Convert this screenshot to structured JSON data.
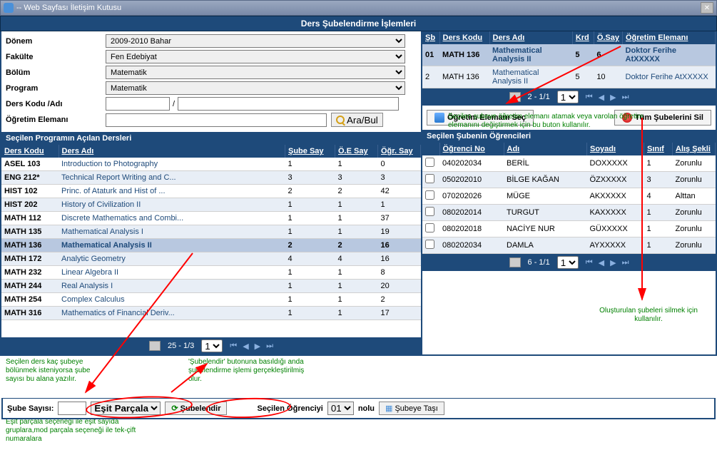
{
  "window": {
    "title": "-- Web Sayfası İletişim Kutusu"
  },
  "header": {
    "title": "Ders Şubelendirme İşlemleri"
  },
  "filters": {
    "donem_label": "Dönem",
    "donem_value": "2009-2010 Bahar",
    "fakulte_label": "Fakülte",
    "fakulte_value": "Fen Edebiyat",
    "bolum_label": "Bölüm",
    "bolum_value": "Matematik",
    "program_label": "Program",
    "program_value": "Matematik",
    "derskodu_label": "Ders Kodu /Adı",
    "kod_value": "",
    "ad_value": "",
    "ogretim_label": "Öğretim Elemanı",
    "oe_value": "",
    "search_label": "Ara/Bul"
  },
  "courses": {
    "section_title": "Seçilen Programın Açılan Dersleri",
    "headers": {
      "kod": "Ders Kodu",
      "ad": "Ders Adı",
      "sube": "Şube Say",
      "oe": "Ö.E Say",
      "ogr": "Öğr. Say"
    },
    "rows": [
      {
        "kod": "ASEL 103",
        "ad": "Introduction to Photography",
        "s": "1",
        "o": "1",
        "g": "0"
      },
      {
        "kod": "ENG 212*",
        "ad": "Technical Report Writing and C...",
        "s": "3",
        "o": "3",
        "g": "3"
      },
      {
        "kod": "HIST 102",
        "ad": "Princ. of Ataturk and Hist of ...",
        "s": "2",
        "o": "2",
        "g": "42"
      },
      {
        "kod": "HIST 202",
        "ad": "History of Civilization II",
        "s": "1",
        "o": "1",
        "g": "1"
      },
      {
        "kod": "MATH 112",
        "ad": "Discrete Mathematics and Combi...",
        "s": "1",
        "o": "1",
        "g": "37"
      },
      {
        "kod": "MATH 135",
        "ad": "Mathematical Analysis I",
        "s": "1",
        "o": "1",
        "g": "19"
      },
      {
        "kod": "MATH 136",
        "ad": "Mathematical Analysis II",
        "s": "2",
        "o": "2",
        "g": "16",
        "sel": true
      },
      {
        "kod": "MATH 172",
        "ad": "Analytic Geometry",
        "s": "4",
        "o": "4",
        "g": "16"
      },
      {
        "kod": "MATH 232",
        "ad": "Linear Algebra II",
        "s": "1",
        "o": "1",
        "g": "8"
      },
      {
        "kod": "MATH 244",
        "ad": "Real Analysis I",
        "s": "1",
        "o": "1",
        "g": "20"
      },
      {
        "kod": "MATH 254",
        "ad": "Complex Calculus",
        "s": "1",
        "o": "1",
        "g": "2"
      },
      {
        "kod": "MATH 316",
        "ad": "Mathematics of Financial Deriv...",
        "s": "1",
        "o": "1",
        "g": "17"
      }
    ],
    "pager": {
      "info": "25 - 1/3",
      "page": "1"
    }
  },
  "sections": {
    "headers": {
      "sb": "Şb",
      "kod": "Ders Kodu",
      "ad": "Ders Adı",
      "krd": "Krd",
      "osay": "Ö.Say",
      "oe": "Öğretim Elemanı"
    },
    "rows": [
      {
        "sb": "01",
        "kod": "MATH 136",
        "ad": "Mathematical Analysis II",
        "krd": "5",
        "osay": "6",
        "oe": "Doktor Ferihe AtXXXXX",
        "sel": true
      },
      {
        "sb": "2",
        "kod": "MATH 136",
        "ad": "Mathematical Analysis II",
        "krd": "5",
        "osay": "10",
        "oe": "Doktor Ferihe AtXXXXX"
      }
    ],
    "pager": {
      "info": "2 - 1/1",
      "page": "1"
    }
  },
  "section_actions": {
    "assign_label": "Öğretim Elemanı Seç",
    "delete_label": "Tüm Şubelerini Sil"
  },
  "students": {
    "section_title": "Seçilen Şubenin Öğrencileri",
    "headers": {
      "no": "Öğrenci No",
      "ad": "Adı",
      "soyad": "Soyadı",
      "sinif": "Sınıf",
      "alis": "Alış Şekli"
    },
    "rows": [
      {
        "no": "040202034",
        "ad": "BERİL",
        "soy": "DOXXXXX",
        "sn": "1",
        "al": "Zorunlu"
      },
      {
        "no": "050202010",
        "ad": "BİLGE KAĞAN",
        "soy": "ÖZXXXXX",
        "sn": "3",
        "al": "Zorunlu"
      },
      {
        "no": "070202026",
        "ad": "MÜGE",
        "soy": "AKXXXXX",
        "sn": "4",
        "al": "Alttan"
      },
      {
        "no": "080202014",
        "ad": "TURGUT",
        "soy": "KAXXXXX",
        "sn": "1",
        "al": "Zorunlu"
      },
      {
        "no": "080202018",
        "ad": "NACİYE NUR",
        "soy": "GÜXXXXX",
        "sn": "1",
        "al": "Zorunlu"
      },
      {
        "no": "080202034",
        "ad": "DAMLA",
        "soy": "AYXXXXX",
        "sn": "1",
        "al": "Zorunlu"
      }
    ],
    "pager": {
      "info": "6 - 1/1",
      "page": "1"
    }
  },
  "hints": {
    "h1": "Seçilen şubeye öğretim elemanı atamak veya varolan öğretim elemanını değiştirmek için bu buton kullanılır.",
    "h2": "Oluşturulan şubeleri silmek için kullanılır.",
    "h3": "Seçilen ders kaç şubeye bölünmek isteniyorsa şube sayısı bu alana yazılır.",
    "h4": "'Şubelendir' butonuna basıldığı anda şubelendirme işlemi gerçekleştirilmiş olur.",
    "h5": "Eşit parçala seçeneği ile eşit sayıda gruplara,mod parçala seçeneği ile tek-çift numaralara"
  },
  "bottom": {
    "sube_label": "Şube Sayısı:",
    "sube_value": "",
    "parcala_value": "Eşit Parçala",
    "sub_btn": "Şubelendir",
    "secilen_label": "Seçilen Öğrenciyi",
    "nolu_value": "01",
    "nolu_label": "nolu",
    "tasi_btn": "Şubeye Taşı"
  }
}
